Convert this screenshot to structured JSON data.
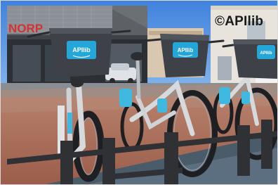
{
  "image": {
    "storefront_sign": "NORP",
    "basket_brand": "APIlib",
    "credit": "©APIlib",
    "colors": {
      "sky": "#4f8fe3",
      "basket": "#3e4147",
      "brand_badge": "#25a6d9",
      "bike_frame": "#d5d8dc",
      "bike_accent": "#3fb9e0",
      "ground": "#a96b56",
      "rack": "#2f3135",
      "storefront_sign": "#d63030"
    }
  }
}
